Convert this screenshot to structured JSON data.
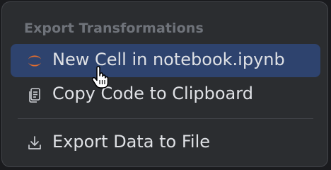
{
  "menu": {
    "header": "Export Transformations",
    "items": [
      {
        "label": "New Cell in notebook.ipynb",
        "icon": "jupyter-icon",
        "selected": true
      },
      {
        "label": "Copy Code to Clipboard",
        "icon": "copy-icon",
        "selected": false
      },
      {
        "label": "Export Data to File",
        "icon": "download-icon",
        "selected": false
      }
    ]
  },
  "colors": {
    "menu_background": "#2b2d30",
    "selected_background": "#2e436e",
    "text": "#dfe1e5",
    "header_text": "#6f737a",
    "jupyter_orange": "#e46e2e"
  }
}
